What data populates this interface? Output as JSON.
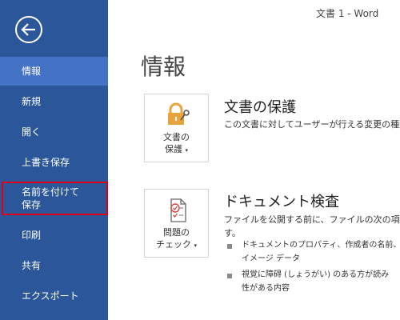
{
  "window": {
    "title": "文書 1 - Word"
  },
  "sidebar": {
    "items": [
      {
        "label": "情報"
      },
      {
        "label": "新規"
      },
      {
        "label": "開く"
      },
      {
        "label": "上書き保存"
      },
      {
        "label_line1": "名前を付けて",
        "label_line2": "保存"
      },
      {
        "label": "印刷"
      },
      {
        "label": "共有"
      },
      {
        "label": "エクスポート"
      }
    ]
  },
  "page": {
    "title": "情報"
  },
  "protect": {
    "button_line1": "文書の",
    "button_line2": "保護",
    "title": "文書の保護",
    "description": "この文書に対してユーザーが行える変更の種類を"
  },
  "inspect": {
    "button_line1": "問題の",
    "button_line2": "チェック",
    "title": "ドキュメント検査",
    "description_line1": "ファイルを公開する前に、ファイルの次の項目",
    "description_line2": "す。",
    "bullets": [
      {
        "line1": "ドキュメントのプロパティ、作成者の名前、ト",
        "line2": "イメージ データ"
      },
      {
        "line1": "視覚に障碍 (しょうがい) のある方が読み",
        "line2": "性がある内容"
      }
    ]
  },
  "colors": {
    "sidebar": "#2b579a",
    "active": "#4472c4",
    "highlight": "#e0001b",
    "lock": "#e8a33d"
  }
}
